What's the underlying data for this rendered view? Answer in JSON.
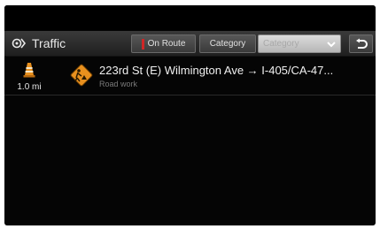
{
  "header": {
    "title": "Traffic",
    "on_route_label": "On Route",
    "category_label": "Category",
    "dropdown_value": "Category"
  },
  "events": [
    {
      "distance": "1.0 mi",
      "title": "223rd St (E) Wilmington Ave → I-405/CA-47...",
      "type": "Road work"
    }
  ],
  "colors": {
    "accent_red": "#d02626",
    "warning_orange": "#e8901e",
    "background": "#050505"
  },
  "icons": {
    "title": "traffic-icon",
    "back": "back-arrow-icon",
    "dropdown": "chevron-down-icon",
    "event_marker": "traffic-cone-icon",
    "event_type": "road-work-icon"
  }
}
